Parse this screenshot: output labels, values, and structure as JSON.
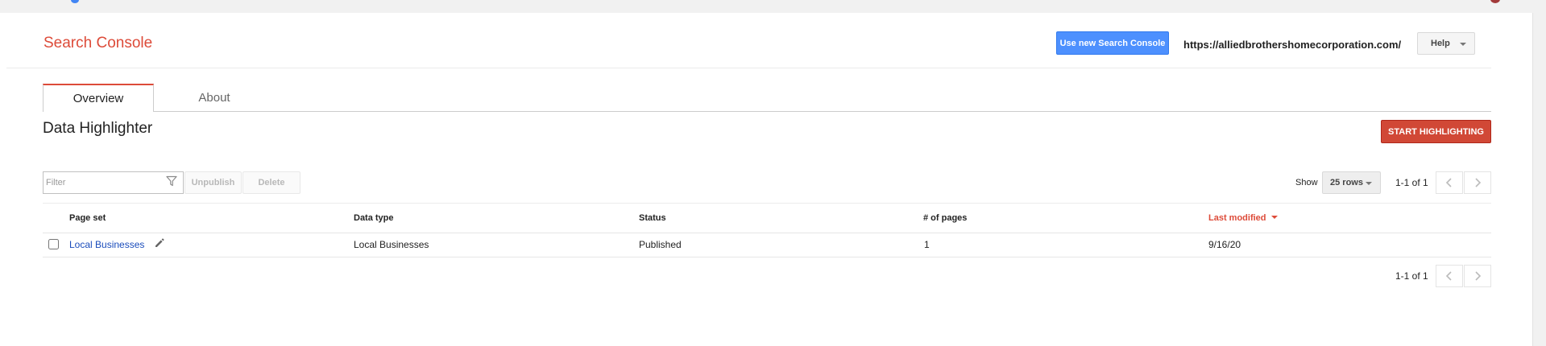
{
  "header": {
    "app_title": "Search Console",
    "new_console_button": "Use new Search Console",
    "site_url": "https://alliedbrothershomecorporation.com/",
    "help_button": "Help",
    "help_caret_icon": "chevron-down-icon"
  },
  "tabs": [
    {
      "label": "Overview",
      "active": true
    },
    {
      "label": "About",
      "active": false
    }
  ],
  "page": {
    "title": "Data Highlighter",
    "start_button": "START HIGHLIGHTING"
  },
  "toolbar": {
    "filter_placeholder": "Filter",
    "filter_value": "",
    "filter_icon": "funnel-icon",
    "unpublish_button": "Unpublish",
    "delete_button": "Delete",
    "show_label": "Show",
    "rows_option": "25 rows"
  },
  "pagination": {
    "top_range": "1-1 of 1",
    "bottom_range": "1-1 of 1",
    "prev_icon": "chevron-left-icon",
    "next_icon": "chevron-right-icon"
  },
  "table": {
    "columns": [
      "Page set",
      "Data type",
      "Status",
      "# of pages",
      "Last modified"
    ],
    "sorted_column": "Last modified",
    "sort_direction": "descending",
    "rows": [
      {
        "checked": false,
        "page_set": "Local Businesses",
        "data_type": "Local Businesses",
        "status": "Published",
        "pages": "1",
        "last_modified": "9/16/20",
        "edit_icon": "pencil-icon"
      }
    ]
  },
  "colors": {
    "brand_red": "#dd4b39",
    "primary_blue": "#4d90fe",
    "start_button_red": "#d14836",
    "link_blue": "#1a4cbb"
  }
}
